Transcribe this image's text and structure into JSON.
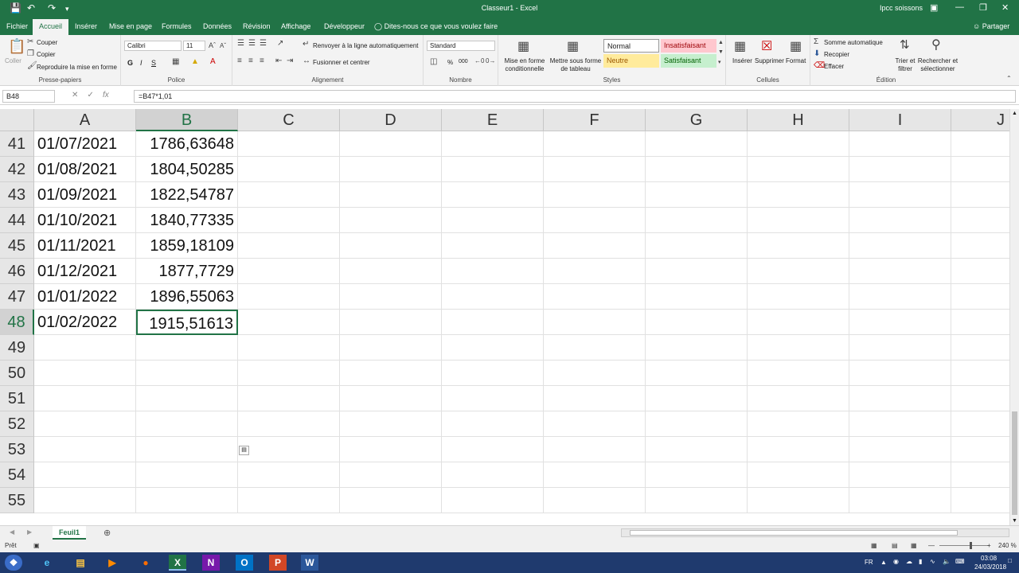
{
  "window": {
    "title": "Classeur1 - Excel",
    "account": "Ipcc soissons"
  },
  "tabs": [
    "Fichier",
    "Accueil",
    "Insérer",
    "Mise en page",
    "Formules",
    "Données",
    "Révision",
    "Affichage",
    "Développeur"
  ],
  "active_tab": "Accueil",
  "tell_me": "Dites-nous ce que vous voulez faire",
  "share_label": "Partager",
  "ribbon": {
    "clipboard": {
      "paste": "Coller",
      "cut": "Couper",
      "copy": "Copier",
      "format_painter": "Reproduire la mise en forme",
      "label": "Presse-papiers"
    },
    "font": {
      "name": "Calibri",
      "size": "11",
      "bold": "G",
      "italic": "I",
      "underline": "S",
      "label": "Police"
    },
    "alignment": {
      "wrap": "Renvoyer à la ligne automatiquement",
      "merge": "Fusionner et centrer",
      "label": "Alignement"
    },
    "number": {
      "format": "Standard",
      "percent": "%",
      "thousands": "000",
      "label": "Nombre"
    },
    "styles": {
      "conditional": "Mise en forme conditionnelle",
      "table": "Mettre sous forme de tableau",
      "normal": "Normal",
      "bad": "Insatisfaisant",
      "neutral": "Neutre",
      "good": "Satisfaisant",
      "label": "Styles"
    },
    "cells": {
      "insert": "Insérer",
      "delete": "Supprimer",
      "format": "Format",
      "label": "Cellules"
    },
    "editing": {
      "autosum": "Somme automatique",
      "fill": "Recopier",
      "clear": "Effacer",
      "sort": "Trier et filtrer",
      "find": "Rechercher et sélectionner",
      "label": "Édition"
    }
  },
  "formula_bar": {
    "name_box": "B48",
    "fx": "fx",
    "formula": "=B47*1,01"
  },
  "columns": [
    "A",
    "B",
    "C",
    "D",
    "E",
    "F",
    "G",
    "H",
    "I",
    "J"
  ],
  "selected_column": "B",
  "rows": [
    {
      "num": "41",
      "a": "01/07/2021",
      "b": "1786,63648"
    },
    {
      "num": "42",
      "a": "01/08/2021",
      "b": "1804,50285"
    },
    {
      "num": "43",
      "a": "01/09/2021",
      "b": "1822,54787"
    },
    {
      "num": "44",
      "a": "01/10/2021",
      "b": "1840,77335"
    },
    {
      "num": "45",
      "a": "01/11/2021",
      "b": "1859,18109"
    },
    {
      "num": "46",
      "a": "01/12/2021",
      "b": "1877,7729"
    },
    {
      "num": "47",
      "a": "01/01/2022",
      "b": "1896,55063"
    },
    {
      "num": "48",
      "a": "01/02/2022",
      "b": "1915,51613"
    },
    {
      "num": "49",
      "a": "",
      "b": ""
    },
    {
      "num": "50",
      "a": "",
      "b": ""
    },
    {
      "num": "51",
      "a": "",
      "b": ""
    },
    {
      "num": "52",
      "a": "",
      "b": ""
    },
    {
      "num": "53",
      "a": "",
      "b": ""
    },
    {
      "num": "54",
      "a": "",
      "b": ""
    },
    {
      "num": "55",
      "a": "",
      "b": ""
    }
  ],
  "selected_row": "48",
  "sheet": {
    "name": "Feuil1"
  },
  "status": {
    "ready": "Prêt",
    "zoom": "240 %"
  },
  "taskbar": {
    "lang": "FR",
    "time": "03:08",
    "date": "24/03/2018"
  },
  "colors": {
    "excel_green": "#217346",
    "taskbar": "#1f3a6e"
  }
}
